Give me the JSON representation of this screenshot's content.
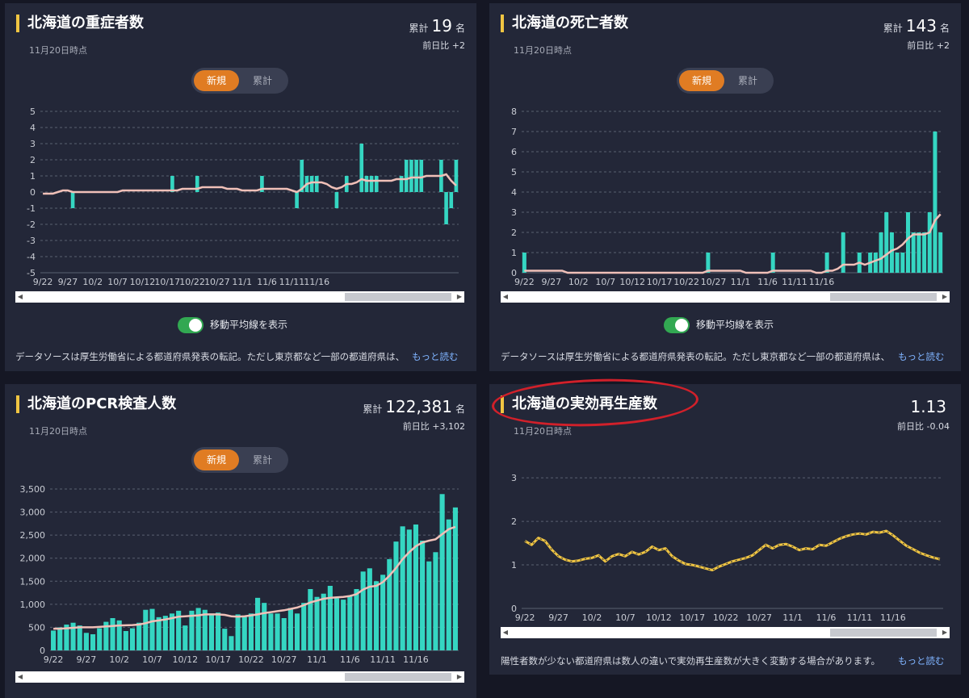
{
  "colors": {
    "bar": "#35d6c2",
    "avg": "#f0c0b8",
    "rt": "#f0c542",
    "grid": "#5a6070",
    "axis": "#c9ccd4",
    "annotation": "#d1202a"
  },
  "panels": [
    {
      "title": "北海道の重症者数",
      "date": "11月20日時点",
      "total_label": "累計",
      "total_value": "19",
      "total_unit": "名",
      "diff": "前日比 +2",
      "toggle": {
        "new": "新規",
        "cum": "累計"
      },
      "ma_label": "移動平均線を表示",
      "note": "データソースは厚生労働省による都道府県発表の転記。ただし東京都など一部の都道府県は、",
      "more": "もっと読む"
    },
    {
      "title": "北海道の死亡者数",
      "date": "11月20日時点",
      "total_label": "累計",
      "total_value": "143",
      "total_unit": "名",
      "diff": "前日比 +2",
      "toggle": {
        "new": "新規",
        "cum": "累計"
      },
      "ma_label": "移動平均線を表示",
      "note": "データソースは厚生労働省による都道府県発表の転記。ただし東京都など一部の都道府県は、",
      "more": "もっと読む"
    },
    {
      "title": "北海道のPCR検査人数",
      "date": "11月20日時点",
      "total_label": "累計",
      "total_value": "122,381",
      "total_unit": "名",
      "diff": "前日比 +3,102",
      "toggle": {
        "new": "新規",
        "cum": "累計"
      }
    },
    {
      "title": "北海道の実効再生産数",
      "date": "11月20日時点",
      "total_value": "1.13",
      "diff": "前日比 -0.04",
      "note": "陽性者数が少ない都道府県は数人の違いで実効再生産数が大きく変動する場合があります。",
      "more": "もっと読む"
    }
  ],
  "chart_data": [
    {
      "type": "bar",
      "title": "北海道の重症者数",
      "ylim": [
        -5,
        5
      ],
      "yticks": [
        "5",
        "4",
        "3",
        "2",
        "1",
        "0",
        "-1",
        "-2",
        "-3",
        "-4",
        "-5"
      ],
      "xticks": [
        "9/22",
        "9/27",
        "10/2",
        "10/7",
        "10/12",
        "10/17",
        "10/22",
        "10/27",
        "11/1",
        "11/6",
        "11/11",
        "11/16"
      ],
      "values": [
        0,
        0,
        0,
        0,
        0,
        0,
        -1,
        0,
        0,
        0,
        0,
        0,
        0,
        0,
        0,
        0,
        0,
        0,
        0,
        0,
        0,
        0,
        0,
        0,
        0,
        0,
        1,
        0,
        0,
        0,
        0,
        1,
        0,
        0,
        0,
        0,
        0,
        0,
        0,
        0,
        0,
        0,
        0,
        0,
        1,
        0,
        0,
        0,
        0,
        0,
        0,
        -1,
        2,
        1,
        1,
        1,
        0,
        0,
        0,
        -1,
        0,
        1,
        0,
        0,
        3,
        1,
        1,
        1,
        0,
        0,
        0,
        0,
        1,
        2,
        2,
        2,
        2,
        0,
        0,
        0,
        2,
        -2,
        -1,
        2
      ],
      "moving_avg": [
        -0.1,
        -0.1,
        -0.1,
        0,
        0.1,
        0.1,
        0,
        0,
        0,
        0,
        0,
        0,
        0,
        0,
        0,
        0,
        0.1,
        0.1,
        0.1,
        0.1,
        0.1,
        0.1,
        0.1,
        0.1,
        0.1,
        0.1,
        0.1,
        0.1,
        0.2,
        0.2,
        0.2,
        0.2,
        0.3,
        0.3,
        0.3,
        0.3,
        0.3,
        0.2,
        0.2,
        0.2,
        0.1,
        0.1,
        0.1,
        0.1,
        0.2,
        0.2,
        0.2,
        0.2,
        0.2,
        0.2,
        0.1,
        0,
        0.2,
        0.5,
        0.6,
        0.6,
        0.6,
        0.5,
        0.3,
        0.2,
        0.3,
        0.5,
        0.5,
        0.6,
        0.8,
        0.7,
        0.7,
        0.7,
        0.7,
        0.7,
        0.7,
        0.8,
        0.8,
        0.8,
        0.9,
        0.9,
        0.9,
        1.0,
        1.0,
        1.0,
        1.0,
        1.1,
        0.7,
        0.4
      ]
    },
    {
      "type": "bar",
      "title": "北海道の死亡者数",
      "ylim": [
        0,
        8
      ],
      "yticks": [
        "8",
        "7",
        "6",
        "5",
        "4",
        "3",
        "2",
        "1",
        "0"
      ],
      "xticks": [
        "9/22",
        "9/27",
        "10/2",
        "10/7",
        "10/12",
        "10/17",
        "10/22",
        "10/27",
        "11/1",
        "11/6",
        "11/11",
        "11/16"
      ],
      "values": [
        1,
        0,
        0,
        0,
        0,
        0,
        0,
        0,
        0,
        0,
        0,
        0,
        0,
        0,
        0,
        0,
        0,
        0,
        0,
        0,
        0,
        0,
        0,
        0,
        0,
        0,
        0,
        0,
        0,
        0,
        0,
        0,
        0,
        0,
        1,
        0,
        0,
        0,
        0,
        0,
        0,
        0,
        0,
        0,
        0,
        0,
        1,
        0,
        0,
        0,
        0,
        0,
        0,
        0,
        0,
        0,
        1,
        0,
        0,
        2,
        0,
        0,
        1,
        0,
        1,
        1,
        2,
        3,
        2,
        1,
        1,
        3,
        2,
        2,
        2,
        3,
        7,
        2
      ],
      "moving_avg": [
        0.1,
        0.1,
        0.1,
        0.1,
        0.1,
        0.1,
        0.1,
        0.1,
        0,
        0,
        0,
        0,
        0,
        0,
        0,
        0,
        0,
        0,
        0,
        0,
        0,
        0,
        0,
        0,
        0,
        0,
        0,
        0,
        0,
        0,
        0,
        0,
        0,
        0,
        0.1,
        0.1,
        0.1,
        0.1,
        0.1,
        0.1,
        0.1,
        0,
        0,
        0,
        0,
        0,
        0.1,
        0.1,
        0.1,
        0.1,
        0.1,
        0.1,
        0.1,
        0.1,
        0,
        0,
        0.1,
        0.1,
        0.2,
        0.4,
        0.4,
        0.4,
        0.5,
        0.4,
        0.5,
        0.6,
        0.7,
        0.9,
        1.1,
        1.2,
        1.4,
        1.7,
        1.9,
        1.9,
        1.9,
        2.0,
        2.6,
        2.9
      ]
    },
    {
      "type": "bar",
      "title": "北海道のPCR検査人数",
      "ylim": [
        0,
        3500
      ],
      "yticks": [
        "3,500",
        "3,000",
        "2,500",
        "2,000",
        "1,500",
        "1,000",
        "500",
        "0"
      ],
      "xticks": [
        "9/22",
        "9/27",
        "10/2",
        "10/7",
        "10/12",
        "10/17",
        "10/22",
        "10/27",
        "11/1",
        "11/6",
        "11/11",
        "11/16"
      ],
      "values": [
        430,
        500,
        560,
        600,
        540,
        380,
        350,
        480,
        620,
        700,
        650,
        420,
        480,
        600,
        880,
        900,
        720,
        750,
        800,
        860,
        540,
        860,
        920,
        880,
        800,
        820,
        470,
        310,
        780,
        730,
        800,
        1140,
        1030,
        800,
        800,
        700,
        920,
        800,
        1030,
        1330,
        1160,
        1230,
        1400,
        1130,
        1100,
        1180,
        1330,
        1710,
        1780,
        1500,
        1640,
        1980,
        2360,
        2690,
        2620,
        2730,
        2380,
        1930,
        2130,
        3390,
        2840,
        3100
      ],
      "moving_avg": [
        470,
        470,
        480,
        490,
        500,
        500,
        500,
        510,
        520,
        530,
        540,
        545,
        550,
        560,
        590,
        630,
        650,
        670,
        700,
        730,
        740,
        750,
        760,
        780,
        780,
        780,
        770,
        740,
        730,
        740,
        760,
        780,
        810,
        830,
        850,
        870,
        900,
        930,
        980,
        1040,
        1080,
        1120,
        1140,
        1150,
        1160,
        1180,
        1220,
        1320,
        1380,
        1400,
        1480,
        1620,
        1790,
        1980,
        2130,
        2260,
        2340,
        2380,
        2410,
        2520,
        2630,
        2680
      ]
    },
    {
      "type": "line",
      "title": "北海道の実効再生産数",
      "ylim": [
        0,
        3.3
      ],
      "yticks": [
        "3",
        "2",
        "1",
        "0"
      ],
      "xticks": [
        "9/22",
        "9/27",
        "10/2",
        "10/7",
        "10/12",
        "10/17",
        "10/22",
        "10/27",
        "11/1",
        "11/6",
        "11/11",
        "11/16"
      ],
      "values": [
        1.55,
        1.46,
        1.62,
        1.55,
        1.35,
        1.2,
        1.12,
        1.08,
        1.1,
        1.14,
        1.16,
        1.22,
        1.08,
        1.2,
        1.25,
        1.2,
        1.3,
        1.24,
        1.3,
        1.42,
        1.34,
        1.38,
        1.2,
        1.1,
        1.02,
        1.0,
        0.96,
        0.92,
        0.88,
        0.96,
        1.02,
        1.08,
        1.12,
        1.16,
        1.22,
        1.34,
        1.46,
        1.38,
        1.46,
        1.48,
        1.42,
        1.34,
        1.38,
        1.36,
        1.46,
        1.44,
        1.52,
        1.6,
        1.66,
        1.7,
        1.72,
        1.7,
        1.76,
        1.74,
        1.78,
        1.68,
        1.56,
        1.44,
        1.36,
        1.28,
        1.22,
        1.17,
        1.13
      ]
    }
  ]
}
